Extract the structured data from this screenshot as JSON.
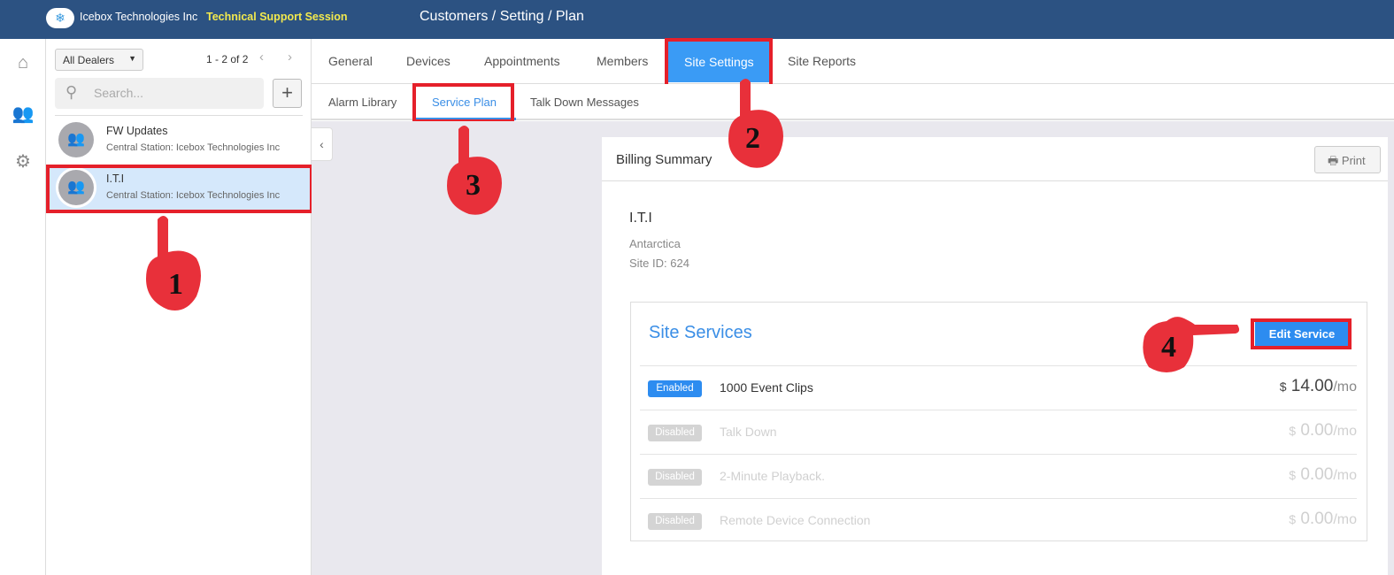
{
  "header": {
    "org": "Icebox Technologies Inc",
    "session": "Technical Support Session",
    "breadcrumb": "Customers / Setting / Plan",
    "logo_icon": "snowflake-icon"
  },
  "rail": [
    "home-icon",
    "users-icon",
    "gear-icon"
  ],
  "list": {
    "filter": "All Dealers",
    "pager": "1 - 2 of 2",
    "search_placeholder": "Search...",
    "add": "+",
    "items": [
      {
        "name": "FW Updates",
        "sub": "Central Station: Icebox Technologies Inc"
      },
      {
        "name": "I.T.I",
        "sub": "Central Station: Icebox Technologies Inc",
        "selected": true
      }
    ]
  },
  "tabs": [
    "General",
    "Devices",
    "Appointments",
    "Members",
    "Site Settings",
    "Site Reports"
  ],
  "active_tab": "Site Settings",
  "subtabs": [
    "Alarm Library",
    "Service Plan",
    "Talk Down Messages"
  ],
  "active_subtab": "Service Plan",
  "billing": {
    "title": "Billing Summary",
    "print": "Print",
    "site": "I.T.I",
    "region": "Antarctica",
    "site_id": "Site ID: 624"
  },
  "services": {
    "title": "Site Services",
    "edit": "Edit Service",
    "rows": [
      {
        "status": "Enabled",
        "name": "1000 Event Clips",
        "currency": "$",
        "price": "14.00",
        "unit": "/mo"
      },
      {
        "status": "Disabled",
        "name": "Talk Down",
        "currency": "$",
        "price": "0.00",
        "unit": "/mo"
      },
      {
        "status": "Disabled",
        "name": "2-Minute Playback.",
        "currency": "$",
        "price": "0.00",
        "unit": "/mo"
      },
      {
        "status": "Disabled",
        "name": "Remote Device Connection",
        "currency": "$",
        "price": "0.00",
        "unit": "/mo"
      }
    ]
  },
  "annotations": [
    "1",
    "2",
    "3",
    "4"
  ],
  "colors": {
    "header": "#2c5282",
    "accent": "#2d8cf0",
    "highlight": "#e5202a"
  }
}
